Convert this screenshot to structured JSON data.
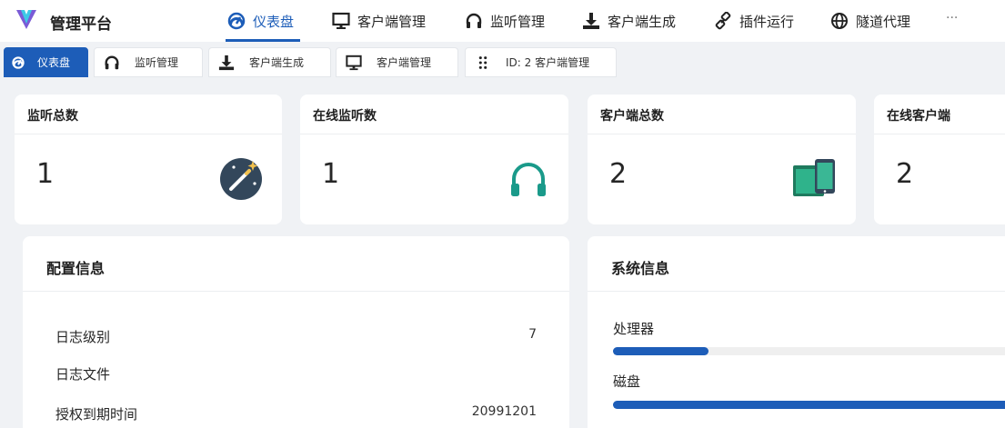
{
  "brand": {
    "name": "管理平台"
  },
  "nav": {
    "items": [
      {
        "label": "仪表盘",
        "icon": "dashboard-icon",
        "active": true
      },
      {
        "label": "客户端管理",
        "icon": "monitor-icon"
      },
      {
        "label": "监听管理",
        "icon": "headphones-icon"
      },
      {
        "label": "客户端生成",
        "icon": "download-icon"
      },
      {
        "label": "插件运行",
        "icon": "plugin-icon"
      },
      {
        "label": "隧道代理",
        "icon": "globe-icon"
      }
    ],
    "more": "···"
  },
  "tabs": [
    {
      "label": "仪表盘",
      "icon": "dashboard-icon",
      "active": true
    },
    {
      "label": "监听管理",
      "icon": "headphones-icon"
    },
    {
      "label": "客户端生成",
      "icon": "download-icon"
    },
    {
      "label": "客户端管理",
      "icon": "monitor-icon"
    },
    {
      "label": "ID: 2 客户端管理",
      "icon": "drag-handle-icon"
    }
  ],
  "stats": [
    {
      "title": "监听总数",
      "value": "1",
      "icon": "magic-wand-icon"
    },
    {
      "title": "在线监听数",
      "value": "1",
      "icon": "headphones-icon"
    },
    {
      "title": "客户端总数",
      "value": "2",
      "icon": "devices-icon"
    },
    {
      "title": "在线客户端",
      "value": "2"
    }
  ],
  "config": {
    "title": "配置信息",
    "rows": [
      {
        "label": "日志级别",
        "value": "7"
      },
      {
        "label": "日志文件",
        "value": ""
      },
      {
        "label": "授权到期时间",
        "value": "20991201"
      }
    ]
  },
  "system": {
    "title": "系统信息",
    "items": [
      {
        "label": "处理器",
        "fraction": 0.23
      },
      {
        "label": "磁盘",
        "fraction": 1.0
      }
    ]
  },
  "colors": {
    "primary": "#1d5db8",
    "teal": "#1a9a8a",
    "dark": "#33475b"
  }
}
